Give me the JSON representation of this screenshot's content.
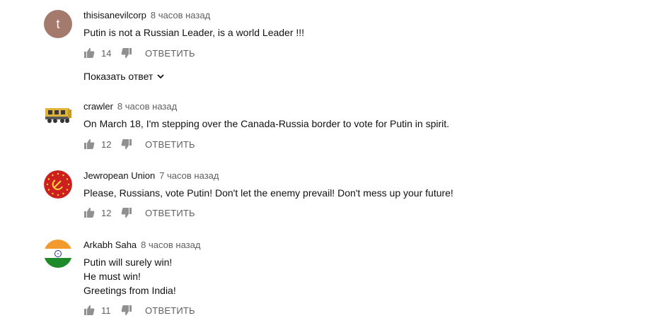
{
  "comments": [
    {
      "author": "thisisanevilcorp",
      "time": "8 часов назад",
      "avatar_letter": "t",
      "text": "Putin is not a Russian Leader, is a world Leader !!!",
      "likes": "14",
      "reply_label": "ОТВЕТИТЬ",
      "show_replies_label": "Показать ответ"
    },
    {
      "author": "crawler",
      "time": "8 часов назад",
      "text": "On March 18, I'm stepping over the Canada-Russia border to vote for Putin in spirit.",
      "likes": "12",
      "reply_label": "ОТВЕТИТЬ"
    },
    {
      "author": "Jewropean Union",
      "time": "7 часов назад",
      "text": "Please, Russians, vote Putin! Don't let the enemy prevail! Don't mess up your future!",
      "likes": "12",
      "reply_label": "ОТВЕТИТЬ"
    },
    {
      "author": "Arkabh Saha",
      "time": "8 часов назад",
      "text": "Putin will surely win!\nHe must win!\nGreetings from India!",
      "likes": "11",
      "reply_label": "ОТВЕТИТЬ"
    }
  ],
  "colors": {
    "secondary_text": "#606060",
    "primary_text": "#111111",
    "avatar_t_bg": "#a47a6d"
  },
  "icons": [
    "thumb-up-icon",
    "thumb-down-icon",
    "chevron-down-icon"
  ]
}
